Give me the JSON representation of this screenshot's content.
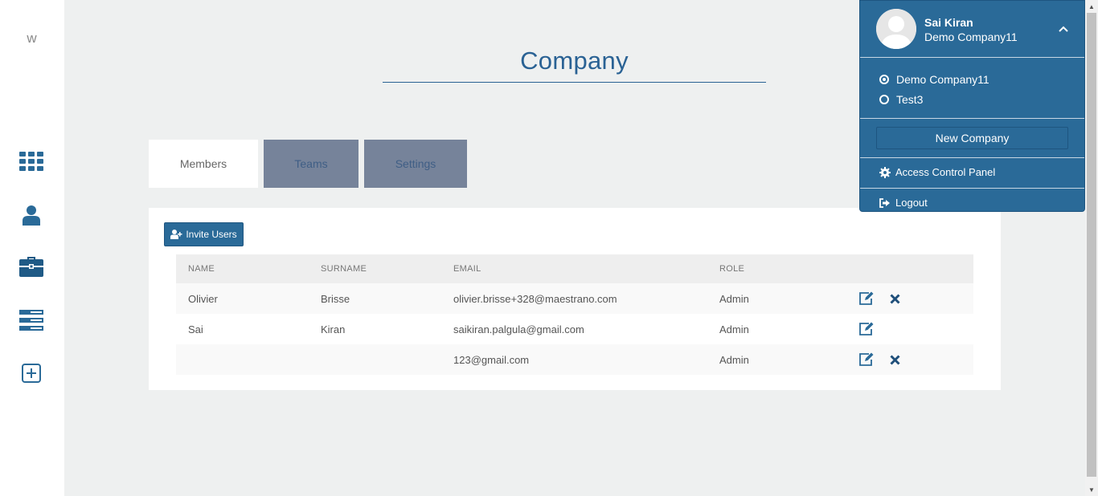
{
  "sidebar": {
    "logo": "w",
    "items": [
      {
        "icon": "grid-icon"
      },
      {
        "icon": "user-icon"
      },
      {
        "icon": "briefcase-icon"
      },
      {
        "icon": "stack-icon"
      },
      {
        "icon": "plus-square-icon"
      }
    ]
  },
  "main": {
    "title": "Company",
    "tabs": [
      {
        "label": "Members",
        "active": true
      },
      {
        "label": "Teams",
        "active": false
      },
      {
        "label": "Settings",
        "active": false
      }
    ]
  },
  "members": {
    "invite_label": "Invite Users",
    "columns": [
      "NAME",
      "SURNAME",
      "EMAIL",
      "ROLE"
    ],
    "rows": [
      {
        "name": "Olivier",
        "surname": "Brisse",
        "email": "olivier.brisse+328@maestrano.com",
        "role": "Admin",
        "deletable": true
      },
      {
        "name": "Sai",
        "surname": "Kiran",
        "email": "saikiran.palgula@gmail.com",
        "role": "Admin",
        "deletable": false
      },
      {
        "name": "",
        "surname": "",
        "email": "123@gmail.com",
        "role": "Admin",
        "deletable": true
      }
    ]
  },
  "user_menu": {
    "user_name": "Sai Kiran",
    "current_company": "Demo Company11",
    "companies": [
      {
        "label": "Demo Company11",
        "selected": true
      },
      {
        "label": "Test3",
        "selected": false
      }
    ],
    "new_company_label": "New Company",
    "access_control_label": "Access Control Panel",
    "logout_label": "Logout"
  },
  "colors": {
    "accent": "#2a6a98",
    "title": "#2a6294",
    "tab_inactive_bg": "#76839a",
    "background": "#eef0f0"
  }
}
